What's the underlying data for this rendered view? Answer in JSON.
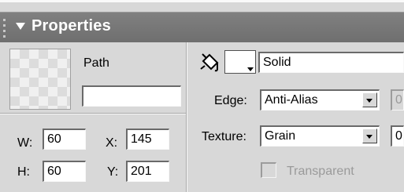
{
  "panel": {
    "title": "Properties"
  },
  "object": {
    "type_label": "Path",
    "name_value": ""
  },
  "dimensions": {
    "w_label": "W:",
    "w_value": "60",
    "h_label": "H:",
    "h_value": "60",
    "x_label": "X:",
    "x_value": "145",
    "y_label": "Y:",
    "y_value": "201"
  },
  "fill": {
    "type_value": "Solid",
    "edge_label": "Edge:",
    "edge_value": "Anti-Alias",
    "edge_amount": "0",
    "texture_label": "Texture:",
    "texture_value": "Grain",
    "texture_amount": "0",
    "transparent_label": "Transparent",
    "swatch_color": "#ffffff"
  },
  "icons": [
    "grip-icon",
    "collapse-triangle-icon",
    "paint-bucket-icon",
    "chevron-down-icon"
  ]
}
